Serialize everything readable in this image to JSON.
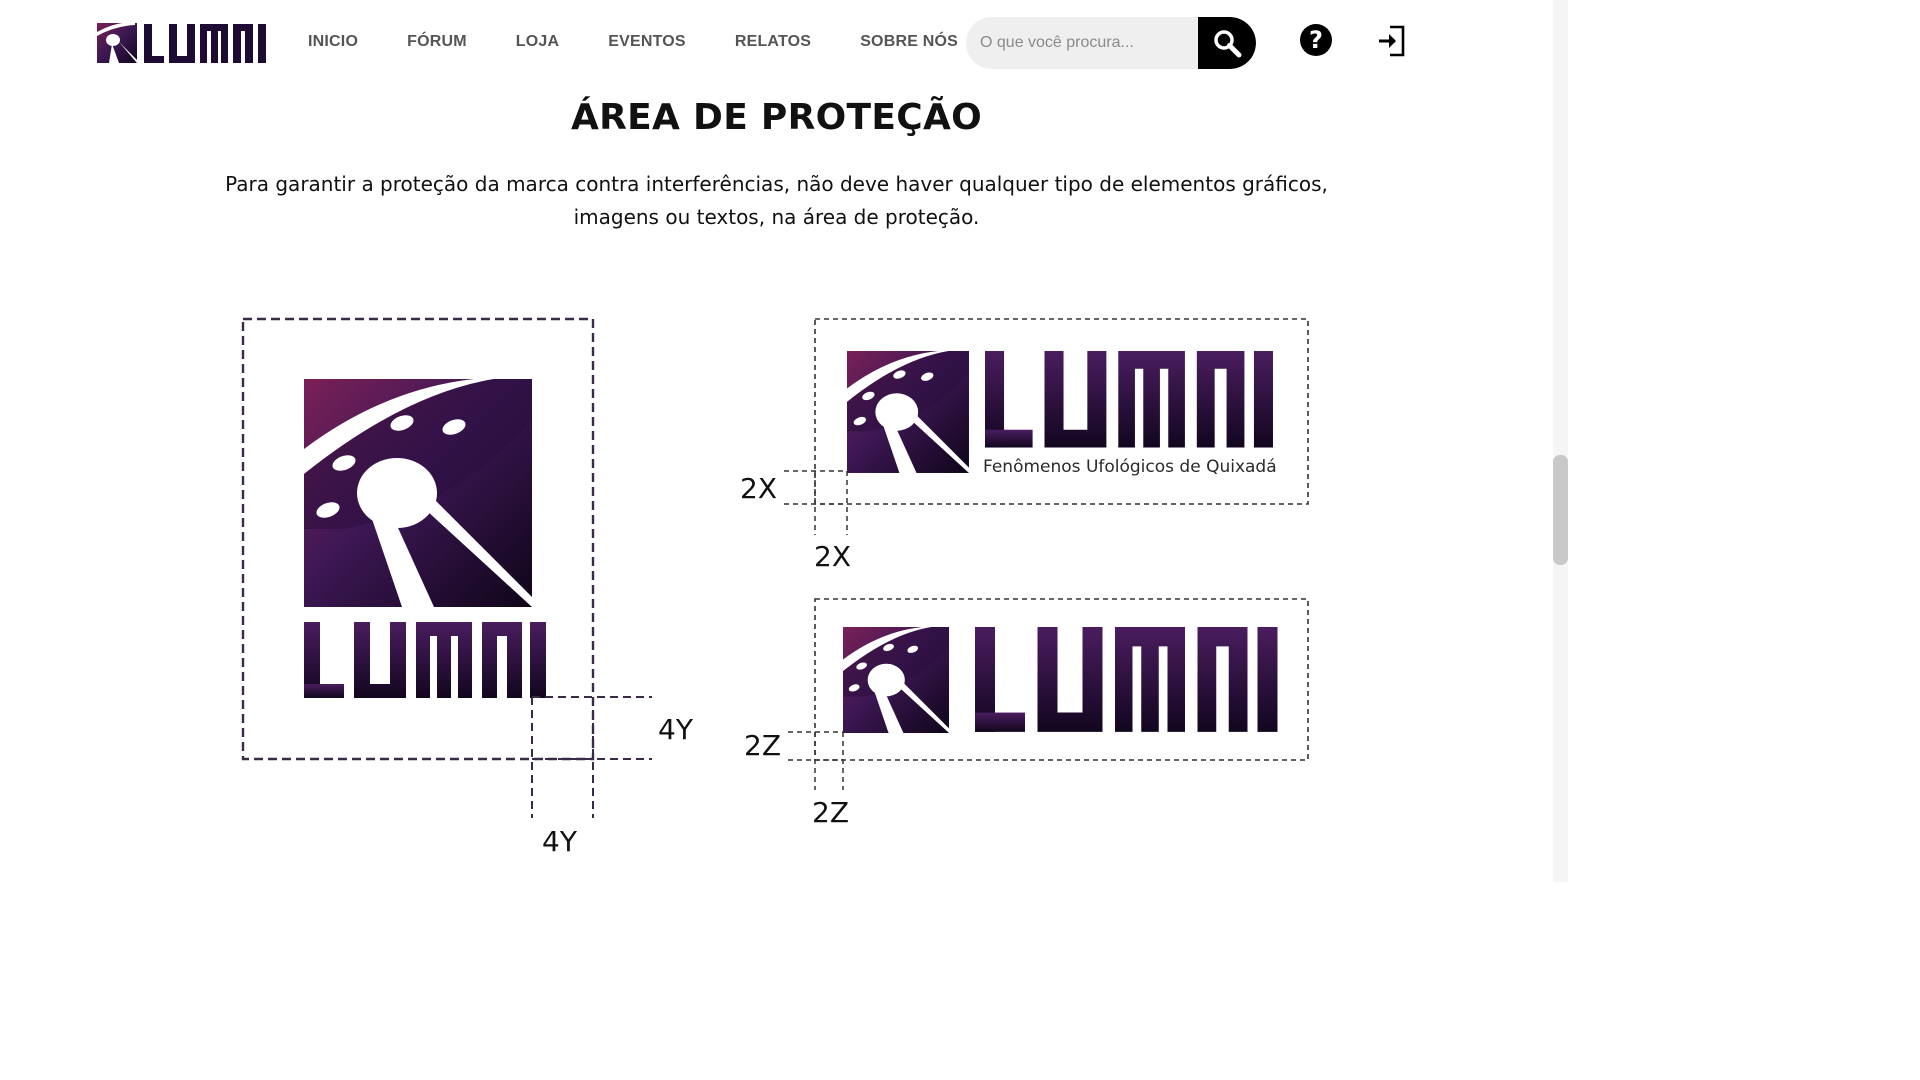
{
  "nav": {
    "brand_name": "LUMNI",
    "items": [
      {
        "label": "INICIO"
      },
      {
        "label": "FÓRUM"
      },
      {
        "label": "LOJA"
      },
      {
        "label": "EVENTOS"
      },
      {
        "label": "RELATOS"
      },
      {
        "label": "SOBRE NÓS"
      }
    ],
    "search": {
      "placeholder": "O que você procura...",
      "value": ""
    },
    "icons": {
      "search": "search-icon",
      "help": "help-icon",
      "login": "login-icon"
    }
  },
  "content": {
    "title": "ÁREA DE PROTEÇÃO",
    "description": "Para garantir a proteção da marca contra interferências, não deve haver qualquer tipo de elementos gráficos, imagens ou textos, na área de proteção."
  },
  "diagram": {
    "logo_wordmark": "LUMNI",
    "logo_subtitle": "Fenômenos Ufológicos de Quixadá",
    "labels": {
      "vertical_h": "4Y",
      "vertical_v": "4Y",
      "horizontal_h": "2X",
      "horizontal_v": "2X",
      "compact_h": "2Z",
      "compact_v": "2Z"
    }
  },
  "colors": {
    "brand_dark": "#1e0b33",
    "brand_purple": "#4a1d5f",
    "brand_magenta": "#7a2057",
    "text": "#111111",
    "nav_text": "#555555",
    "guide_dash": "#3a2a4a"
  }
}
